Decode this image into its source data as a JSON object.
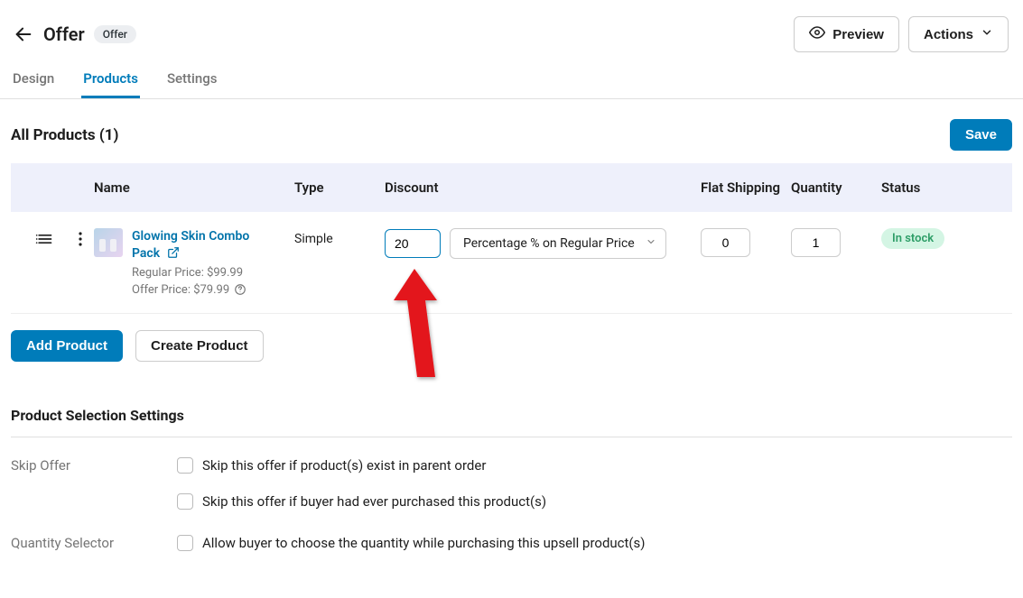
{
  "header": {
    "title": "Offer",
    "pill": "Offer",
    "preview_label": "Preview",
    "actions_label": "Actions"
  },
  "tabs": {
    "design": "Design",
    "products": "Products",
    "settings": "Settings"
  },
  "section": {
    "title": "All Products (1)",
    "save_label": "Save"
  },
  "columns": {
    "name": "Name",
    "type": "Type",
    "discount": "Discount",
    "shipping": "Flat Shipping",
    "quantity": "Quantity",
    "status": "Status"
  },
  "row": {
    "product_name": "Glowing Skin Combo Pack",
    "type": "Simple",
    "discount_value": "20",
    "discount_type": "Percentage % on Regular Price",
    "shipping": "0",
    "quantity": "1",
    "status": "In stock",
    "regular_price": "Regular Price: $99.99",
    "offer_price": "Offer Price: $79.99"
  },
  "buttons": {
    "add_product": "Add Product",
    "create_product": "Create Product"
  },
  "settings_section": {
    "title": "Product Selection Settings",
    "skip_offer_label": "Skip Offer",
    "skip_exist": "Skip this offer if product(s) exist in parent order",
    "skip_purchased": "Skip this offer if buyer had ever purchased this product(s)",
    "quantity_selector_label": "Quantity Selector",
    "allow_quantity": "Allow buyer to choose the quantity while purchasing this upsell product(s)"
  }
}
